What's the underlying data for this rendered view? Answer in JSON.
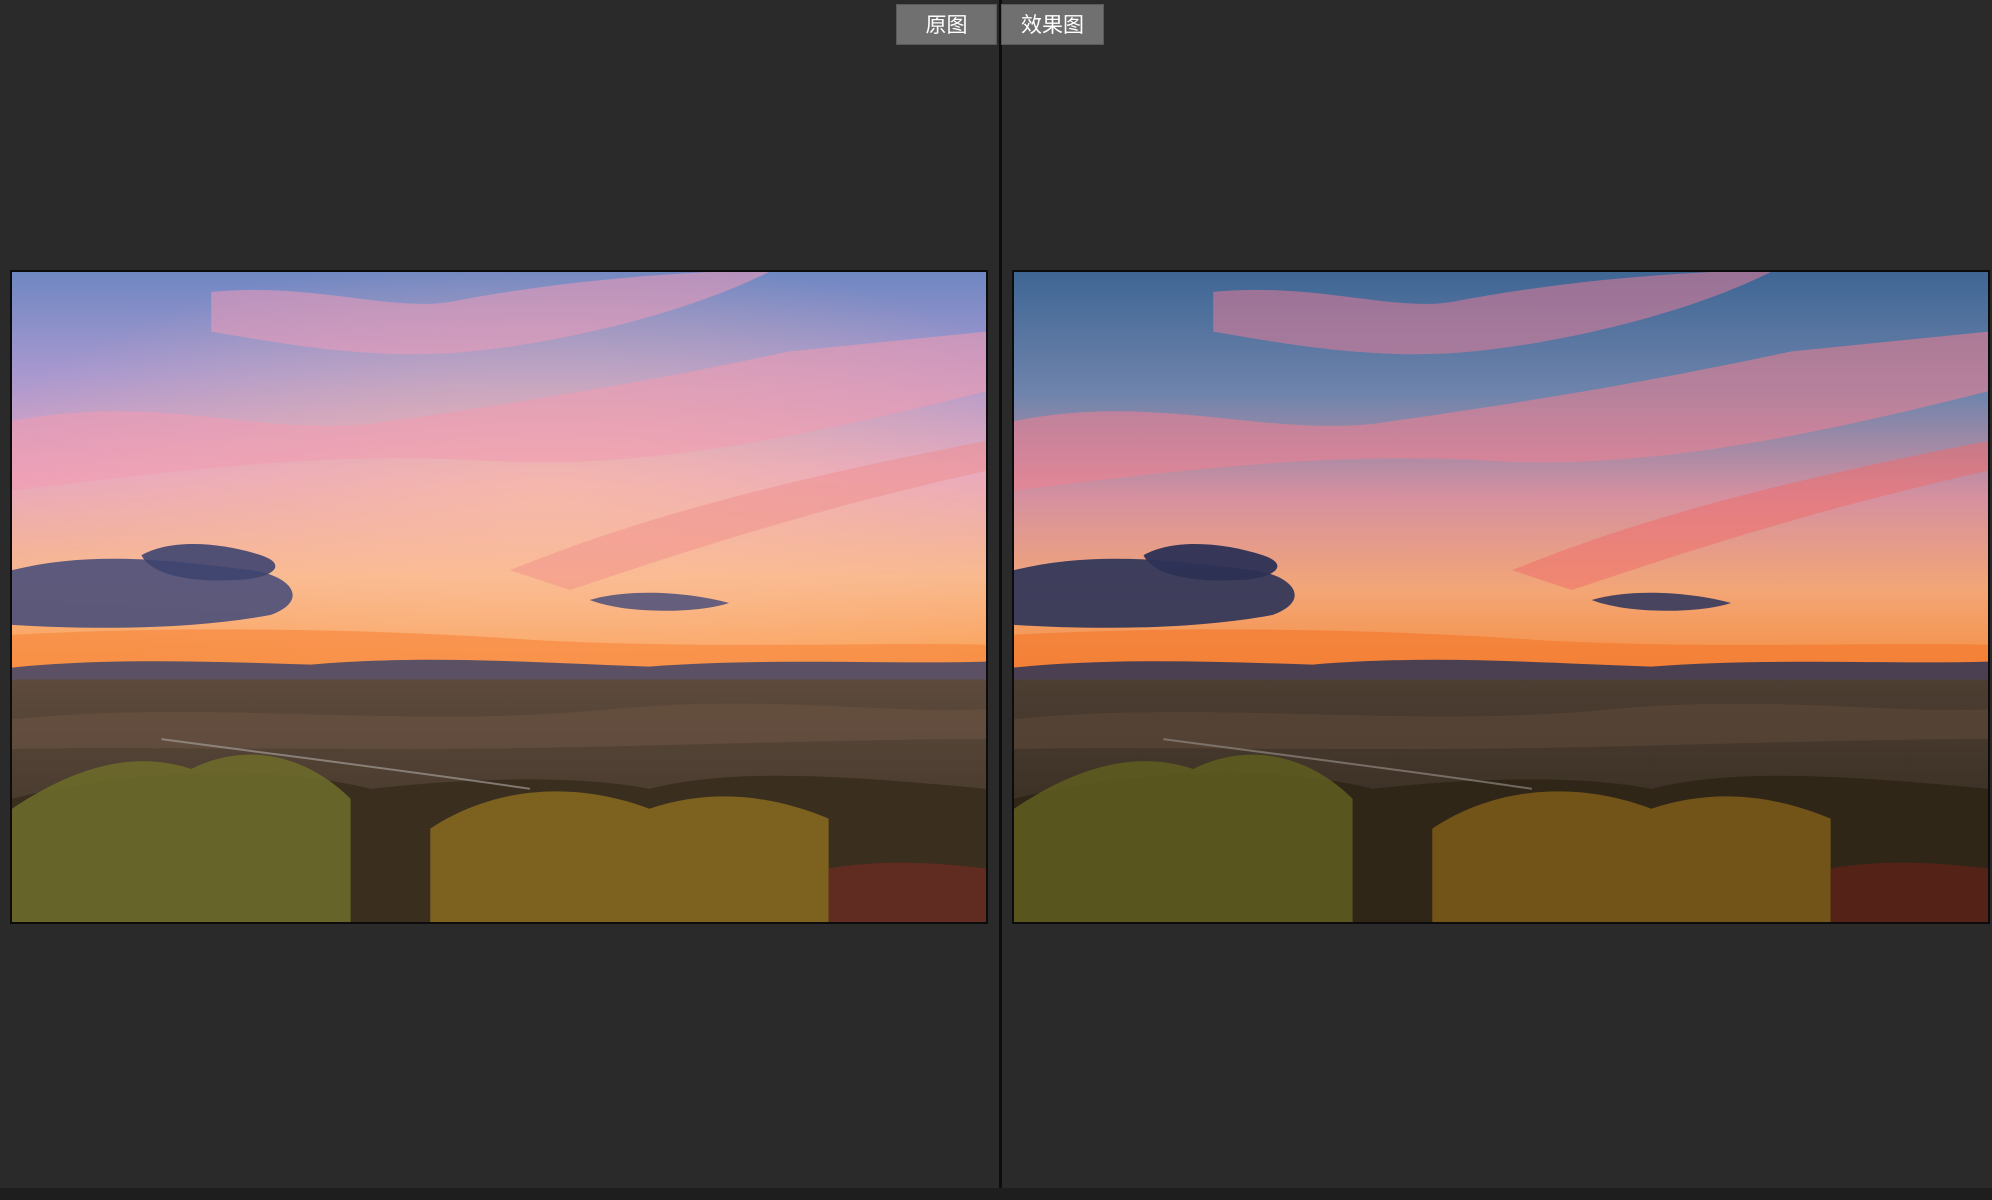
{
  "toolbar": {
    "original_label": "原图",
    "effect_label": "效果图"
  },
  "images": {
    "before": {
      "name": "original-landscape-photo"
    },
    "after": {
      "name": "edited-landscape-photo"
    }
  },
  "colors": {
    "background": "#2a2a2a",
    "button": "#707070",
    "divider": "#0d0d0d"
  }
}
